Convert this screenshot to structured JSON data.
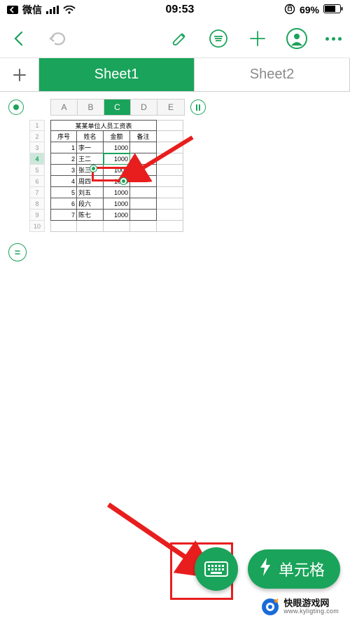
{
  "status": {
    "carrier": "微信",
    "time": "09:53",
    "battery_pct": "69%"
  },
  "tabs": {
    "sheet1": "Sheet1",
    "sheet2": "Sheet2"
  },
  "columns": [
    "A",
    "B",
    "C",
    "D",
    "E"
  ],
  "selected_column": "C",
  "rows": [
    "1",
    "2",
    "3",
    "4",
    "5",
    "6",
    "7",
    "8",
    "9",
    "10"
  ],
  "selected_row": "4",
  "table": {
    "title": "某某单位人员工资表",
    "headers": {
      "seq": "序号",
      "name": "姓名",
      "amount": "金额",
      "note": "备注"
    },
    "rows": [
      {
        "seq": "1",
        "name": "李一",
        "amount": "1000",
        "note": ""
      },
      {
        "seq": "2",
        "name": "王二",
        "amount": "1000",
        "note": ""
      },
      {
        "seq": "3",
        "name": "张三",
        "amount": "1000",
        "note": ""
      },
      {
        "seq": "4",
        "name": "周四",
        "amount": "1000",
        "note": ""
      },
      {
        "seq": "5",
        "name": "刘五",
        "amount": "1000",
        "note": ""
      },
      {
        "seq": "6",
        "name": "段六",
        "amount": "1000",
        "note": ""
      },
      {
        "seq": "7",
        "name": "陈七",
        "amount": "1000",
        "note": ""
      }
    ]
  },
  "selected_cell_value": "1000",
  "eq_label": "=",
  "fab": {
    "cell_label": "单元格"
  },
  "watermark": {
    "title": "快眼游戏网",
    "url": "www.kyligting.com"
  }
}
